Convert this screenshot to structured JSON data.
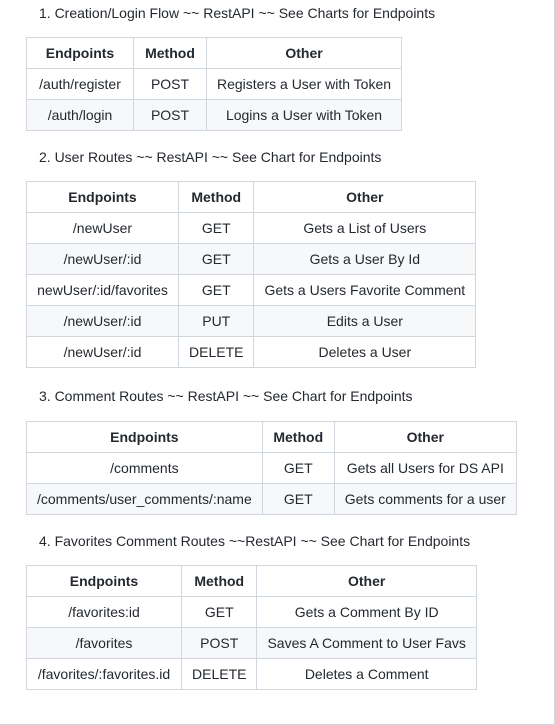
{
  "sections": [
    {
      "heading": "1. Creation/Login Flow ~~ RestAPI ~~ See Charts for Endpoints",
      "headers": [
        "Endpoints",
        "Method",
        "Other"
      ],
      "rows": [
        [
          "/auth/register",
          "POST",
          "Registers a User with Token"
        ],
        [
          "/auth/login",
          "POST",
          "Logins a User with Token"
        ]
      ]
    },
    {
      "heading": "2. User Routes ~~ RestAPI ~~ See Chart for Endpoints",
      "headers": [
        "Endpoints",
        "Method",
        "Other"
      ],
      "rows": [
        [
          "/newUser",
          "GET",
          "Gets a List of Users"
        ],
        [
          "/newUser/:id",
          "GET",
          "Gets a User By Id"
        ],
        [
          "newUser/:id/favorites",
          "GET",
          "Gets a Users Favorite Comment"
        ],
        [
          "/newUser/:id",
          "PUT",
          "Edits a User"
        ],
        [
          "/newUser/:id",
          "DELETE",
          "Deletes a User"
        ]
      ]
    },
    {
      "heading": "3. Comment Routes ~~ RestAPI ~~ See Chart for Endpoints",
      "headers": [
        "Endpoints",
        "Method",
        "Other"
      ],
      "rows": [
        [
          "/comments",
          "GET",
          "Gets all Users for DS API"
        ],
        [
          "/comments/user_comments/:name",
          "GET",
          "Gets comments for a user"
        ]
      ]
    },
    {
      "heading": "4. Favorites Comment Routes ~~RestAPI ~~ See Chart for Endpoints",
      "headers": [
        "Endpoints",
        "Method",
        "Other"
      ],
      "rows": [
        [
          "/favorites:id",
          "GET",
          "Gets a Comment By ID"
        ],
        [
          "/favorites",
          "POST",
          "Saves A Comment to User Favs"
        ],
        [
          "/favorites/:favorites.id",
          "DELETE",
          "Deletes a Comment"
        ]
      ]
    }
  ]
}
